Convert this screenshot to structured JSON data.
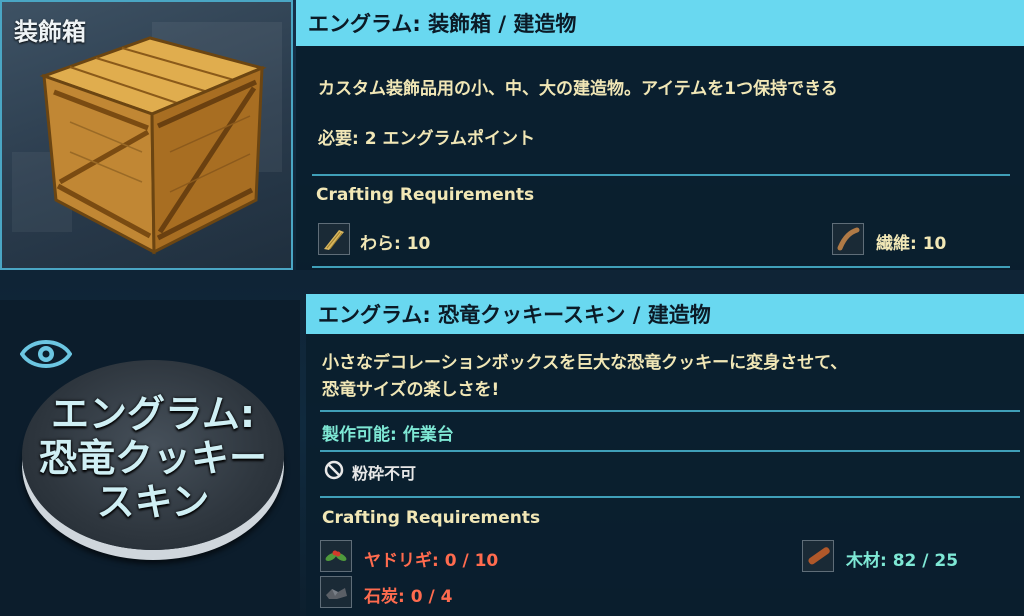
{
  "item": {
    "name": "装飾箱"
  },
  "engram1": {
    "header": "エングラム: 装飾箱 / 建造物",
    "description": "カスタム装飾品用の小、中、大の建造物。アイテムを1つ保持できる",
    "requirement": "必要: 2 エングラムポイント",
    "crafting_title": "Crafting Requirements",
    "resources": [
      {
        "name": "わら: 10",
        "icon": "straw-icon"
      },
      {
        "name": "繊維: 10",
        "icon": "fiber-icon"
      }
    ]
  },
  "engram2": {
    "header": "エングラム: 恐竜クッキースキン / 建造物",
    "description_line1": "小さなデコレーションボックスを巨大な恐竜クッキーに変身させて、",
    "description_line2": "恐竜サイズの楽しさを!",
    "craftable": "製作可能: 作業台",
    "no_grind": "粉砕不可",
    "crafting_title": "Crafting Requirements",
    "resources": [
      {
        "name": "ヤドリギ: 0 / 10",
        "icon": "mistletoe-icon",
        "status": "insufficient"
      },
      {
        "name": "木材: 82 / 25",
        "icon": "wood-icon",
        "status": "sufficient"
      },
      {
        "name": "石炭: 0 / 4",
        "icon": "coal-icon",
        "status": "insufficient"
      }
    ],
    "badge": {
      "line1": "エングラム:",
      "line2": "恐竜クッキー",
      "line3": "スキン"
    }
  },
  "colors": {
    "header_bg": "#69d8f0",
    "text_gold": "#f1e7b6",
    "ok_teal": "#7ee8d5",
    "missing_red": "#ff6b4e"
  }
}
